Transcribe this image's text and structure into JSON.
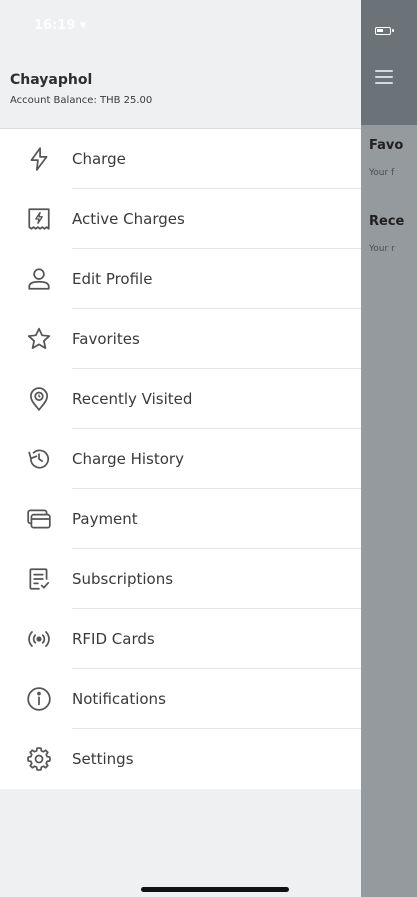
{
  "status_bar": {
    "time": "16:19 ▾"
  },
  "account": {
    "name": "Chayaphol",
    "balance": "Account Balance: THB 25.00"
  },
  "menu": [
    {
      "label": "Charge",
      "icon": "lightning-icon"
    },
    {
      "label": "Active Charges",
      "icon": "charging-receipt-icon"
    },
    {
      "label": "Edit Profile",
      "icon": "user-icon"
    },
    {
      "label": "Favorites",
      "icon": "star-icon"
    },
    {
      "label": "Recently Visited",
      "icon": "location-history-icon"
    },
    {
      "label": "Charge History",
      "icon": "history-icon"
    },
    {
      "label": "Payment",
      "icon": "credit-card-icon"
    },
    {
      "label": "Subscriptions",
      "icon": "subscription-list-icon"
    },
    {
      "label": "RFID Cards",
      "icon": "rfid-icon"
    },
    {
      "label": "Notifications",
      "icon": "info-icon"
    },
    {
      "label": "Settings",
      "icon": "gear-icon"
    }
  ],
  "main": {
    "sections": [
      {
        "title": "Favo",
        "subtitle": "Your f"
      },
      {
        "title": "Rece",
        "subtitle": "Your r"
      }
    ]
  },
  "colors": {
    "icon": "#555555",
    "overlay": "#959a9e",
    "header_overlay": "#6b7378"
  }
}
